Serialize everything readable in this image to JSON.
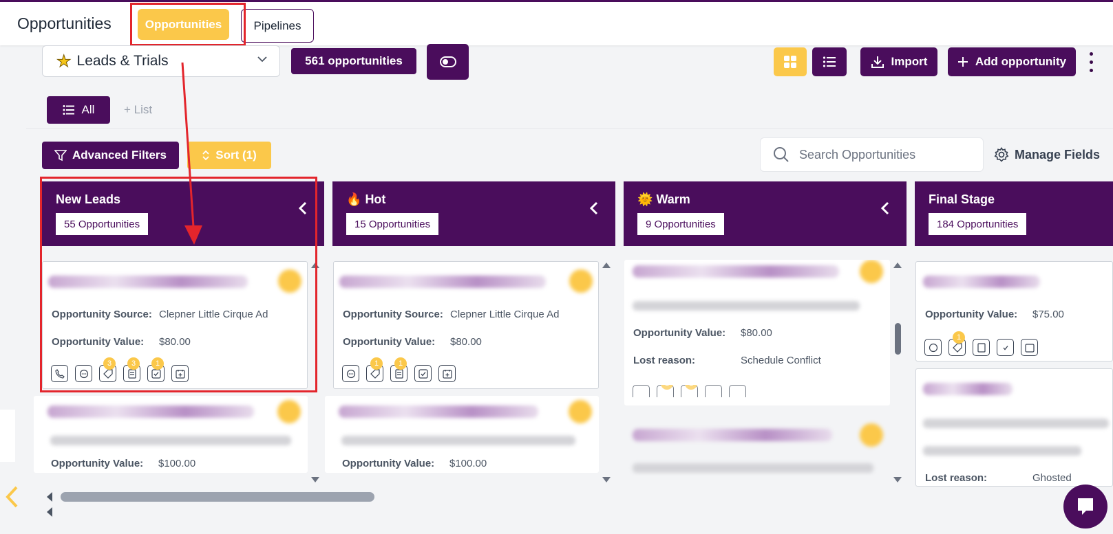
{
  "header": {
    "title": "Opportunities",
    "tabs": [
      {
        "label": "Opportunities",
        "active": true
      },
      {
        "label": "Pipelines",
        "active": false
      }
    ]
  },
  "toolbar": {
    "pipeline": "Leads & Trials",
    "count_label": "561 opportunities",
    "import_label": "Import",
    "add_label": "Add opportunity"
  },
  "lists": {
    "all_label": "All",
    "add_list_label": "List"
  },
  "filters": {
    "advanced_label": "Advanced Filters",
    "sort_label": "Sort (1)",
    "search_placeholder": "Search Opportunities",
    "manage_fields_label": "Manage Fields"
  },
  "columns": [
    {
      "title": "New Leads",
      "emoji": "",
      "count": "55 Opportunities",
      "cards": [
        {
          "fields": [
            {
              "label": "Opportunity Source:",
              "value": "Clepner Little Cirque Ad"
            },
            {
              "label": "Opportunity Value:",
              "value": "$80.00"
            }
          ],
          "badges": [
            "",
            "",
            "3",
            "3",
            "1",
            ""
          ]
        },
        {
          "fields": [
            {
              "label": "Opportunity Value:",
              "value": "$100.00"
            }
          ]
        }
      ]
    },
    {
      "title": "Hot",
      "emoji": "🔥",
      "count": "15 Opportunities",
      "cards": [
        {
          "fields": [
            {
              "label": "Opportunity Source:",
              "value": "Clepner Little Cirque Ad"
            },
            {
              "label": "Opportunity Value:",
              "value": "$80.00"
            }
          ],
          "badges": [
            "",
            "1",
            "1",
            "",
            ""
          ]
        },
        {
          "fields": [
            {
              "label": "Opportunity Value:",
              "value": "$100.00"
            }
          ]
        }
      ]
    },
    {
      "title": "Warm",
      "emoji": "🌞",
      "count": "9 Opportunities",
      "cards": [
        {
          "fields": [
            {
              "label": "Opportunity Value:",
              "value": "$80.00"
            },
            {
              "label": "Lost reason:",
              "value": "Schedule Conflict"
            }
          ],
          "badges": [
            "",
            "1",
            "1",
            "",
            ""
          ]
        }
      ]
    },
    {
      "title": "Final Stage",
      "emoji": "",
      "count": "184 Opportunities",
      "cards": [
        {
          "fields": [
            {
              "label": "Opportunity Value:",
              "value": "$75.00"
            }
          ],
          "badges": [
            "",
            "1",
            "",
            "",
            ""
          ]
        },
        {
          "fields": [
            {
              "label": "Lost reason:",
              "value": "Ghosted"
            }
          ]
        }
      ]
    }
  ],
  "colors": {
    "brand_purple": "#4a0d5c",
    "accent_yellow": "#fbc84a",
    "highlight_red": "#e3252c"
  }
}
